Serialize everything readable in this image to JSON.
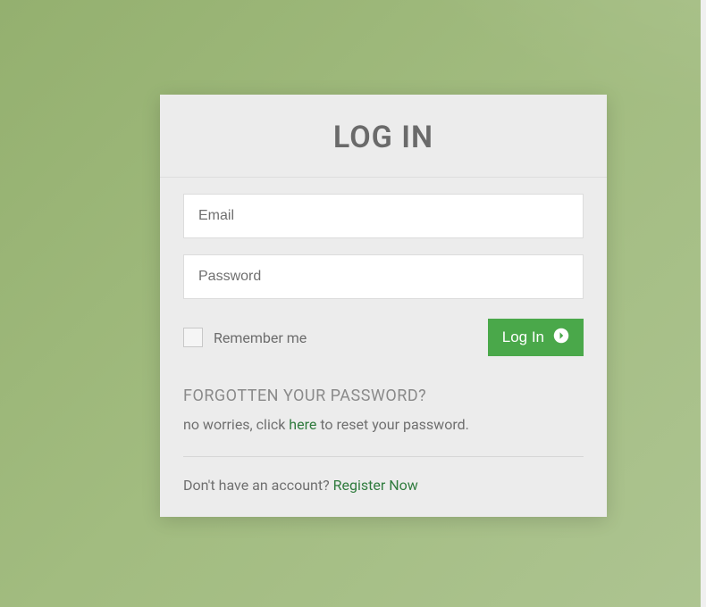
{
  "header": {
    "title": "LOG IN"
  },
  "form": {
    "email_placeholder": "Email",
    "password_placeholder": "Password",
    "remember_label": "Remember me",
    "submit_label": "Log In"
  },
  "forgot": {
    "title": "FORGOTTEN YOUR PASSWORD?",
    "prefix": "no worries, click ",
    "link": "here",
    "suffix": " to reset your password."
  },
  "register": {
    "prefix": "Don't have an account? ",
    "link": "Register Now"
  },
  "colors": {
    "accent": "#4aa84a",
    "link": "#2f7b3d"
  }
}
